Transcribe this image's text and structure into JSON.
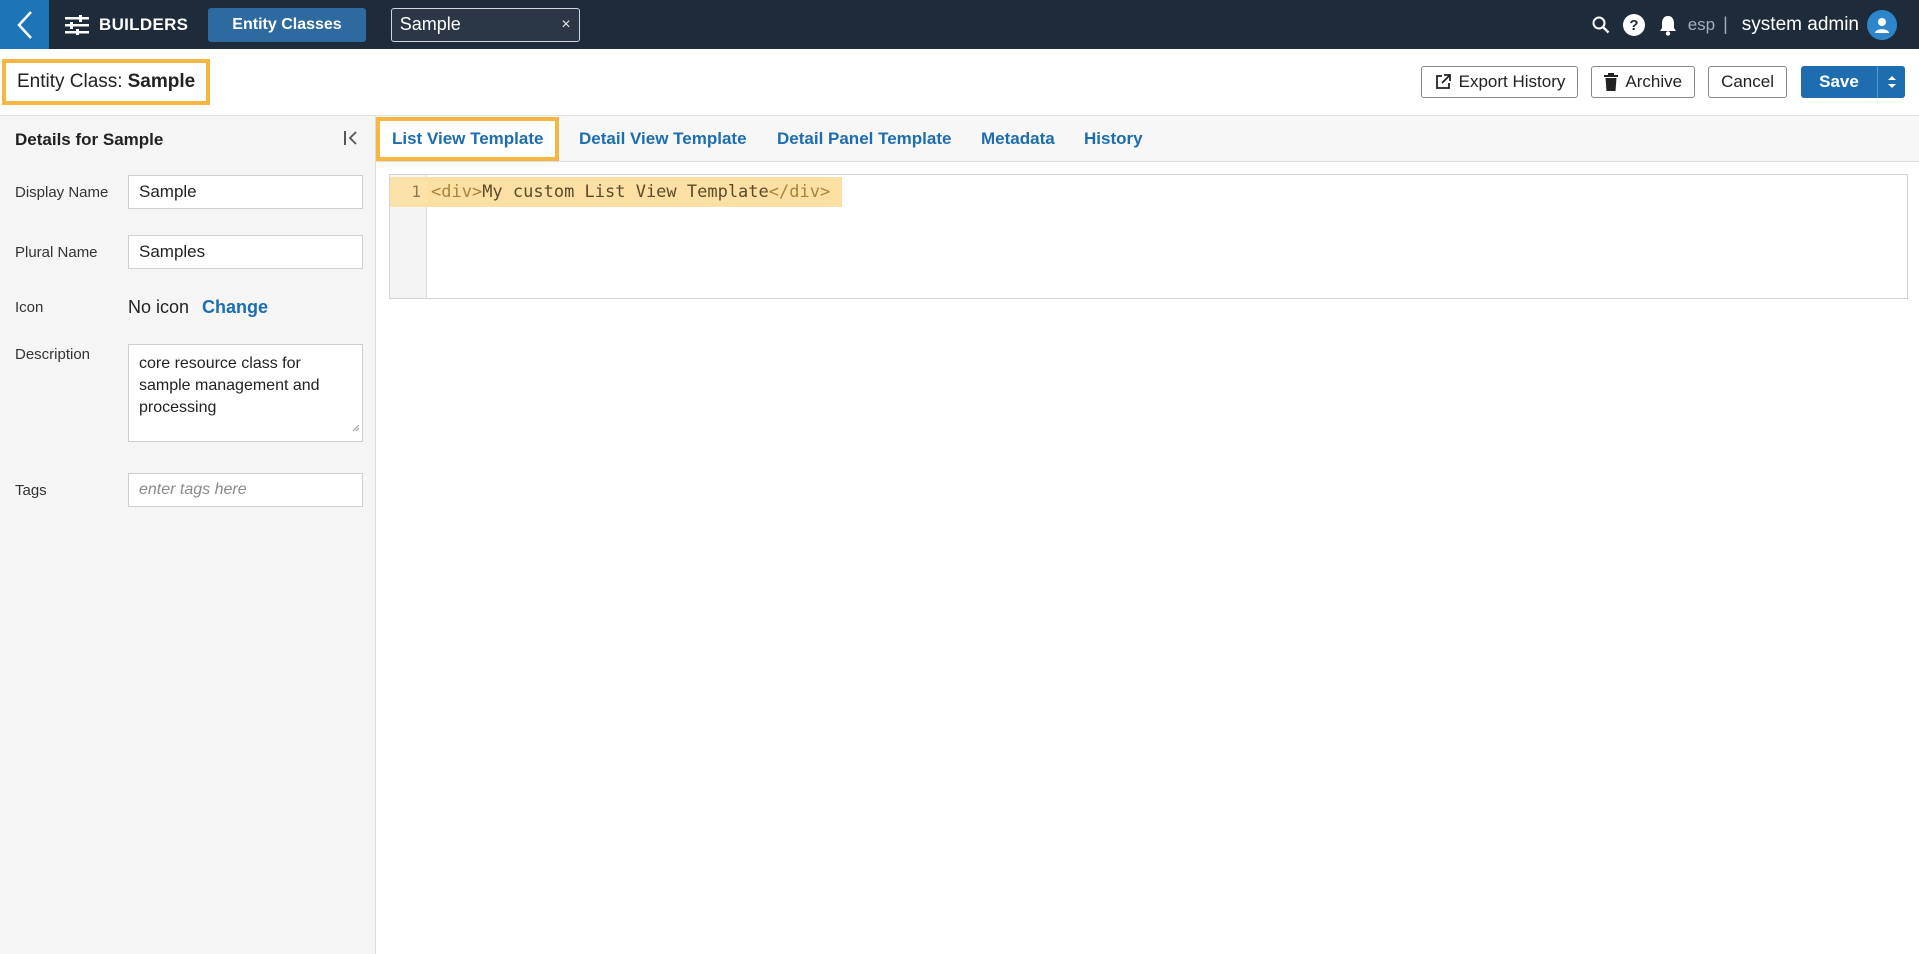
{
  "topnav": {
    "section": "BUILDERS",
    "active_pill": "Entity Classes",
    "open_tab": "Sample",
    "close_glyph": "×",
    "org": "esp",
    "separator": "|",
    "user": "system admin"
  },
  "header": {
    "title_prefix": "Entity Class:",
    "title_name": "Sample",
    "actions": {
      "export": "Export History",
      "archive": "Archive",
      "cancel": "Cancel",
      "save": "Save"
    }
  },
  "sidebar": {
    "title": "Details for Sample",
    "fields": {
      "display_name_label": "Display Name",
      "display_name_value": "Sample",
      "plural_name_label": "Plural Name",
      "plural_name_value": "Samples",
      "icon_label": "Icon",
      "icon_value": "No icon",
      "icon_change": "Change",
      "description_label": "Description",
      "description_value": "core resource class for sample management and processing",
      "tags_label": "Tags",
      "tags_placeholder": "enter tags here"
    }
  },
  "tabs": [
    {
      "label": "List View Template"
    },
    {
      "label": "Detail View Template"
    },
    {
      "label": "Detail Panel Template"
    },
    {
      "label": "Metadata"
    },
    {
      "label": "History"
    }
  ],
  "editor": {
    "line_number": "1",
    "open_tag": "<div>",
    "content": "My custom List View Template",
    "close_tag": "</div>"
  },
  "colors": {
    "nav_bg": "#1e2b3a",
    "accent_blue": "#1f6db1",
    "highlight_orange": "#f6b63f"
  }
}
